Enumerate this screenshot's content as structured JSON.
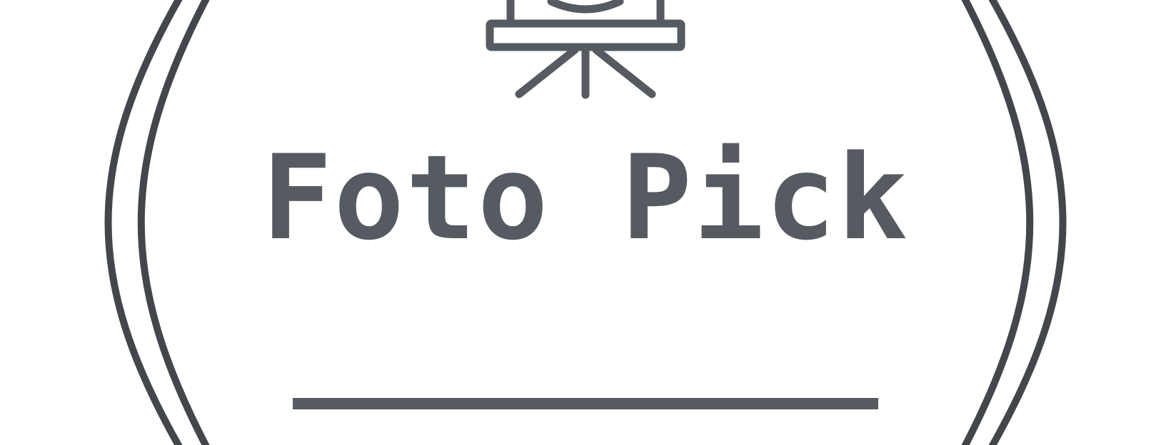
{
  "brand": {
    "name": "Foto Pick"
  },
  "colors": {
    "ring": "#43474c",
    "mark": "#565b61",
    "text": "#565b61",
    "background": "#ffffff"
  },
  "icons": {
    "camera": "camera-on-tripod-icon"
  }
}
